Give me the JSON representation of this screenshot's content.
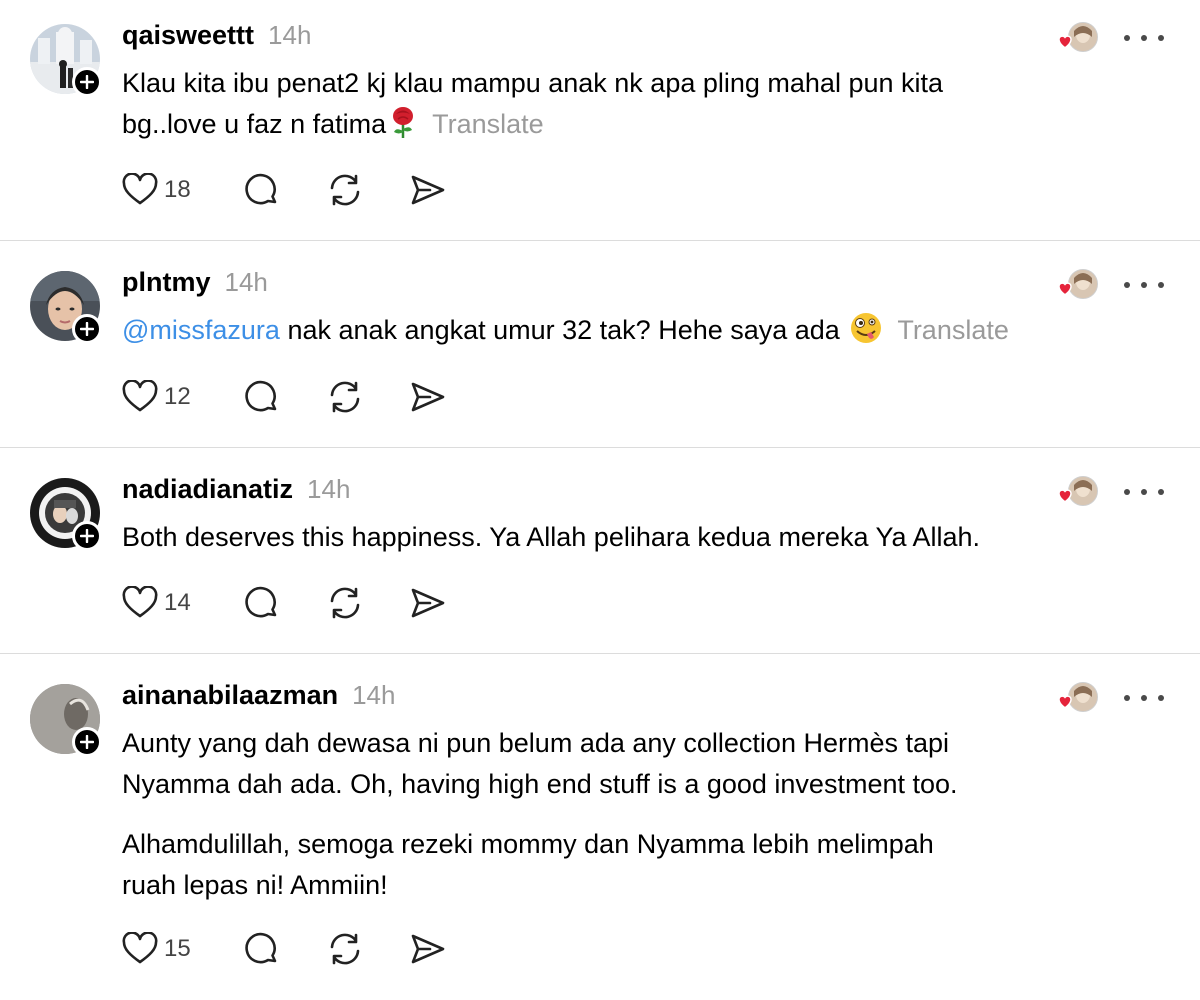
{
  "posts": [
    {
      "username": "qaisweettt",
      "time": "14h",
      "text_parts": [
        "Klau kita ibu penat2 kj klau mampu anak nk apa pling mahal pun kita",
        "bg..love u faz n fatima"
      ],
      "emoji": "rose-emoji",
      "translate": "Translate",
      "likes": "18"
    },
    {
      "username": "plntmy",
      "time": "14h",
      "mention": "@missfazura",
      "text": " nak anak angkat umur 32 tak? Hehe saya ada ",
      "emoji": "zany-face-emoji",
      "translate": "Translate",
      "likes": "12"
    },
    {
      "username": "nadiadianatiz",
      "time": "14h",
      "text": "Both deserves this happiness. Ya Allah pelihara kedua mereka Ya Allah.",
      "likes": "14"
    },
    {
      "username": "ainanabilaazman",
      "time": "14h",
      "paragraphs": [
        [
          "Aunty yang dah dewasa ni pun belum ada any collection Hermès tapi",
          "Nyamma dah ada. Oh, having high end stuff is a good investment too."
        ],
        [
          "Alhamdulillah, semoga rezeki mommy dan Nyamma lebih melimpah",
          "ruah lepas ni! Ammiin!"
        ]
      ],
      "likes": "15"
    }
  ],
  "colors": {
    "mention": "#3d8fe6",
    "muted": "#9a9a9a",
    "heart": "#e5243b",
    "divider": "#dcdcdc"
  }
}
